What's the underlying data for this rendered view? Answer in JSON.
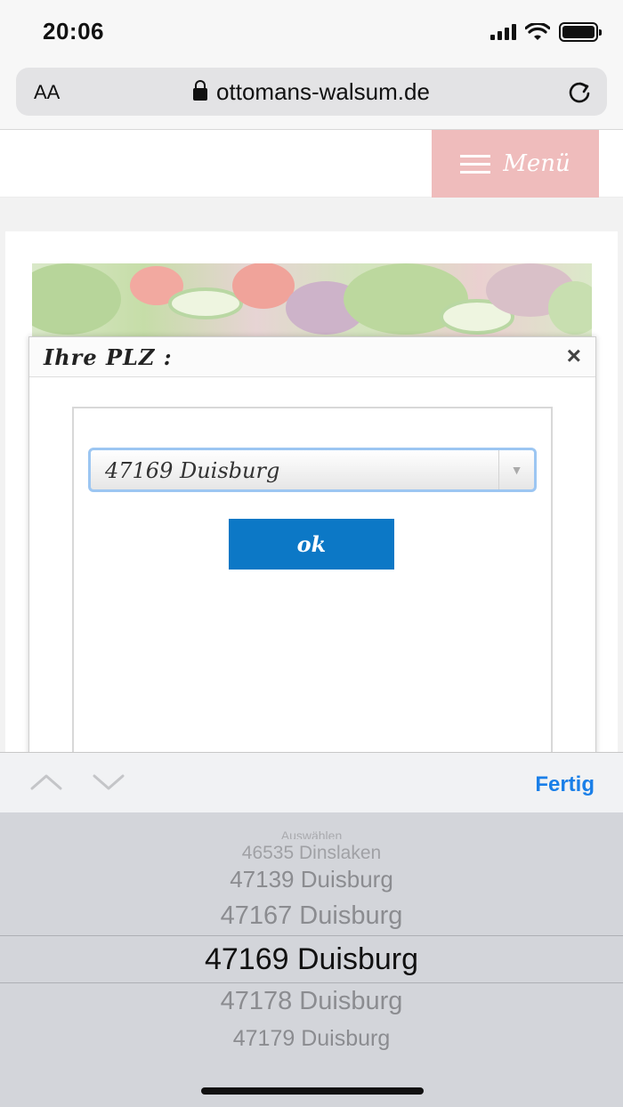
{
  "status_bar": {
    "time": "20:06"
  },
  "browser": {
    "text_size_label": "AA",
    "url": "ottomans-walsum.de"
  },
  "site": {
    "menu_label": "Menü"
  },
  "modal": {
    "title": "Ihre PLZ :",
    "close_label": "×",
    "select_value": "47169 Duisburg",
    "ok_label": "ok"
  },
  "picker": {
    "done_label": "Fertig",
    "options": [
      {
        "label": "Auswählen"
      },
      {
        "label": "46535 Dinslaken"
      },
      {
        "label": "47139 Duisburg"
      },
      {
        "label": "47167 Duisburg"
      },
      {
        "label": "47169 Duisburg"
      },
      {
        "label": "47178 Duisburg"
      },
      {
        "label": "47179 Duisburg"
      }
    ],
    "selected_index": 4
  },
  "colors": {
    "menu_button": "#efbcbc",
    "ok_button": "#0c78c6",
    "done_link": "#1a7fe8",
    "picker_bg": "#d3d5da"
  }
}
